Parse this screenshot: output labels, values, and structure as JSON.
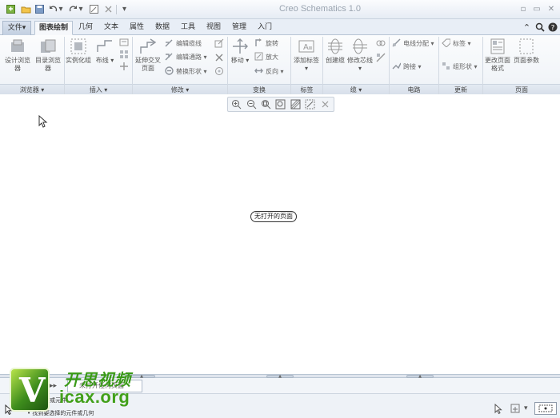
{
  "app": {
    "title": "Creo Schematics 1.0"
  },
  "tabs": [
    {
      "label": "文件",
      "chevron": "▾"
    },
    {
      "label": "图表绘制"
    },
    {
      "label": "几何"
    },
    {
      "label": "文本"
    },
    {
      "label": "属性"
    },
    {
      "label": "数据"
    },
    {
      "label": "工具"
    },
    {
      "label": "视图"
    },
    {
      "label": "管理"
    },
    {
      "label": "入门"
    }
  ],
  "ribbon": {
    "groups": [
      {
        "label": "浏览器",
        "chevron": "▾"
      },
      {
        "label": "插入",
        "chevron": "▾"
      },
      {
        "label": "修改",
        "chevron": "▾"
      },
      {
        "label": "变换"
      },
      {
        "label": "标签"
      },
      {
        "label": "缆",
        "chevron": "▾"
      },
      {
        "label": "电路"
      },
      {
        "label": "更新"
      },
      {
        "label": "页面"
      }
    ],
    "big_buttons": {
      "design_browser": [
        "设计浏览",
        "器"
      ],
      "catalog_browser": [
        "目录浏览",
        "器"
      ],
      "instantiate": "实例化组",
      "wire": "布线",
      "extend_cross": [
        "延伸交叉",
        "页面"
      ],
      "move": "移动",
      "add_label": "添加标签",
      "create_cable": "创建缆",
      "modify_core": "修改芯线",
      "change_page_format": [
        "更改页面",
        "格式"
      ],
      "page_params": "页面参数"
    },
    "small_buttons": {
      "edit_wire": "编辑缆线",
      "edit_path": "编辑通路",
      "replace_shape": "替换形状",
      "rotate": "旋转",
      "zoom_in": "放大",
      "reverse": "反向",
      "wire_assign": "电线分配",
      "jumper": "跨接",
      "tag": "标签",
      "group_shape": "组形状"
    }
  },
  "canvas": {
    "status_text": "无打开的页面"
  },
  "page_tab": {
    "label": "未打开任何页面"
  },
  "messages": [
    "选择图纸或元件。",
    "• 找到要选择的元件或几何"
  ],
  "watermark": {
    "cn": "开思视频",
    "url": "icax.org",
    "letter": "V"
  }
}
